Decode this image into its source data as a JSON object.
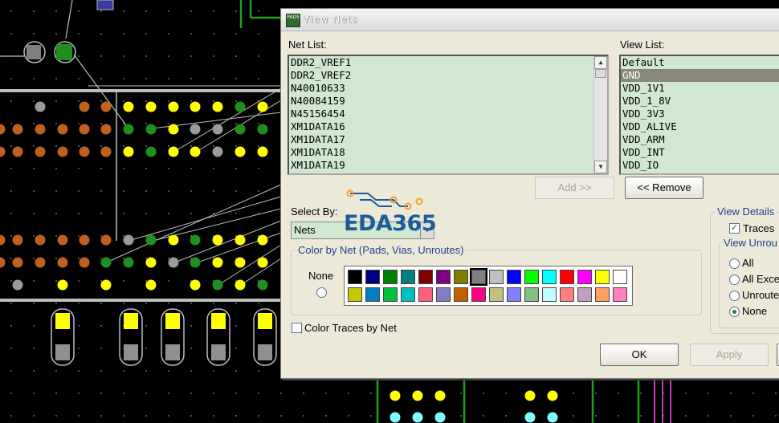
{
  "dialog": {
    "title": "View Nets",
    "app_icon_text": "PADS",
    "net_list_label": "Net List:",
    "net_list": [
      "DDR2_VREF1",
      "DDR2_VREF2",
      "N40010633",
      "N40084159",
      "N45156454",
      "XM1DATA16",
      "XM1DATA17",
      "XM1DATA18",
      "XM1DATA19"
    ],
    "view_list_label": "View List:",
    "view_list": [
      "Default",
      "GND",
      "VDD_1V1",
      "VDD_1_8V",
      "VDD_3V3",
      "VDD_ALIVE",
      "VDD_ARM",
      "VDD_INT",
      "VDD_IO"
    ],
    "view_list_selected": 1,
    "add_button": "Add >>",
    "remove_button": "<< Remove",
    "select_by_label": "Select By:",
    "select_by_value": "Nets",
    "color_group_title": "Color by Net (Pads, Vias, Unroutes)",
    "none_label": "None",
    "palette_row1": [
      "#000000",
      "#000080",
      "#008000",
      "#008080",
      "#800000",
      "#800080",
      "#808000",
      "#808080",
      "#c0c0c0",
      "#0000ff",
      "#00ff00",
      "#00ffff",
      "#ff0000",
      "#ff00ff",
      "#ffff00",
      "#ffffff"
    ],
    "palette_row2": [
      "#c8c800",
      "#0080c0",
      "#00c040",
      "#00c0c0",
      "#ff6080",
      "#8080c0",
      "#c06000",
      "#ff0080",
      "#c0c080",
      "#8080ff",
      "#80c080",
      "#c0ffff",
      "#ff8080",
      "#c0a0c0",
      "#ffa060",
      "#ff80c0"
    ],
    "palette_selected": 7,
    "color_traces_label": "Color Traces by Net",
    "view_details_title": "View Details",
    "traces_label": "Traces",
    "view_unroutes_title": "View Unrou",
    "unroute_options": [
      "All",
      "All Exce",
      "Unroute",
      "None"
    ],
    "unroute_selected": 3,
    "ok_button": "OK",
    "apply_button": "Apply"
  },
  "watermark": {
    "text": "EDA365",
    "color": "#1c5b9c",
    "accent": "#f0a030"
  }
}
